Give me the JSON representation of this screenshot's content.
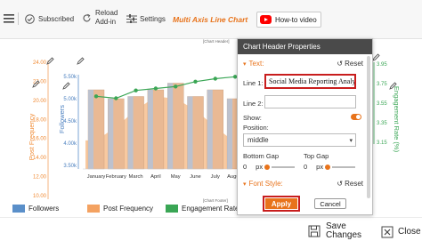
{
  "toolbar": {
    "subscribed_label": "Subscribed",
    "reload_line1": "Reload",
    "reload_line2": "Add-in",
    "settings_label": "Settings",
    "chart_name": "Multi Axis Line Chart",
    "video_label": "How-to video"
  },
  "chart": {
    "header_placeholder": "[Chart Header]",
    "footer_placeholder": "[Chart Footer]",
    "left_axis_label": "Post Frequency",
    "left_axis_ticks": [
      "24.00",
      "22.00",
      "20.00",
      "18.00",
      "16.00",
      "14.00",
      "12.00",
      "10.00"
    ],
    "mid_axis_label": "Followers",
    "mid_axis_ticks": [
      "5.50k",
      "5.00k",
      "4.50k",
      "4.00k",
      "3.50k"
    ],
    "right_axis_label": "Engagement Rate (%)",
    "right_axis_ticks": [
      "3.95",
      "3.75",
      "3.55",
      "3.35",
      "3.15"
    ]
  },
  "chart_data": {
    "type": "bar",
    "categories": [
      "January",
      "February",
      "March",
      "April",
      "May",
      "June",
      "July",
      "August"
    ],
    "series": [
      {
        "name": "Followers",
        "type": "bar",
        "axis": "Followers",
        "values": [
          5200,
          5000,
          5050,
          5200,
          5350,
          5050,
          5200,
          5000
        ]
      },
      {
        "name": "Post Frequency",
        "type": "area",
        "axis": "Post Frequency",
        "values": [
          15.8,
          17.2,
          19.0,
          20.4,
          20.2,
          19.0,
          17.2,
          15.6
        ]
      },
      {
        "name": "Engagement Rate (%)",
        "type": "line",
        "axis": "Engagement Rate (%)",
        "values": [
          3.62,
          3.6,
          3.68,
          3.7,
          3.72,
          3.77,
          3.8,
          3.82
        ]
      }
    ],
    "ylim_left": [
      10,
      24
    ],
    "ylim_mid": [
      3500,
      5500
    ],
    "ylim_right": [
      3.15,
      3.95
    ]
  },
  "legend": {
    "items": [
      {
        "label": "Followers",
        "color": "#5a8fc9"
      },
      {
        "label": "Post Frequency",
        "color": "#f4a261"
      },
      {
        "label": "Engagement Rate (%)",
        "color": "#3aa655"
      }
    ]
  },
  "panel": {
    "title": "Chart Header Properties",
    "text_section": "Text:",
    "reset_label": "Reset",
    "line1_label": "Line 1:",
    "line1_value": "Social Media Reporting Analysis",
    "line2_label": "Line 2:",
    "line2_value": "",
    "show_label": "Show:",
    "position_label": "Position:",
    "position_value": "middle",
    "bottom_gap_label": "Bottom Gap",
    "top_gap_label": "Top Gap",
    "gap_unit": "px",
    "bottom_gap_value": 0,
    "top_gap_value": 0,
    "font_section": "Font Style:",
    "apply_label": "Apply",
    "cancel_label": "Cancel"
  },
  "bottom": {
    "save_line1": "Save",
    "save_line2": "Changes",
    "close_label": "Close"
  },
  "colors": {
    "accent": "#e8731b",
    "followers": "#5a8fc9",
    "post_frequency": "#f4a261",
    "engagement": "#3aa655",
    "highlight": "#c81d1d"
  }
}
